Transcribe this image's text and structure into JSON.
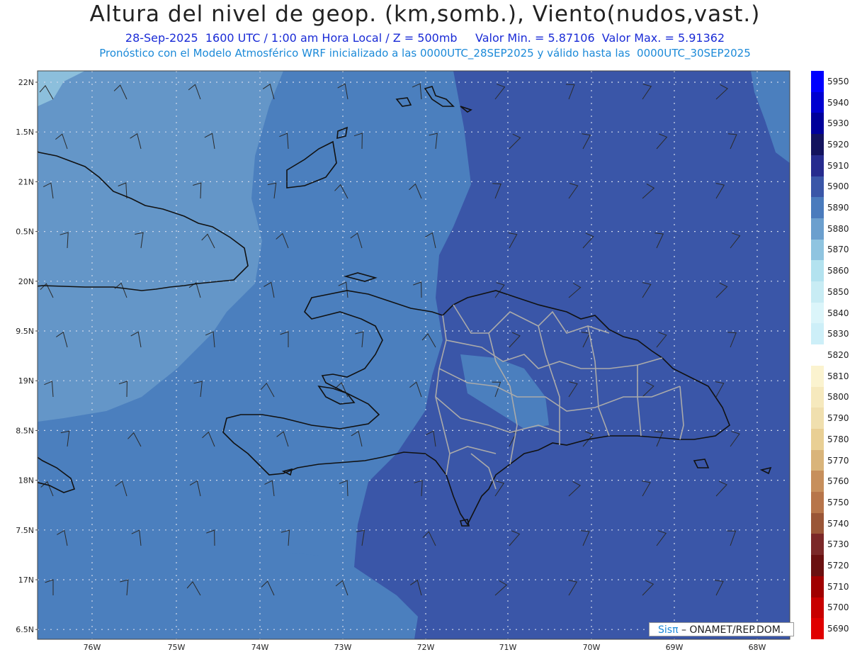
{
  "title": "Altura del nivel de geop. (km,somb.), Viento(nudos,vast.)",
  "subtitle_line1": "28-Sep-2025  1600 UTC / 1:00 am Hora Local / Z = 500mb     Valor Min. = 5.87106  Valor Max. = 5.91362",
  "subtitle_line2": "Pronóstico con el Modelo Atmosférico WRF inicializado a las 0000UTC_28SEP2025 y válido hasta las  0000UTC_30SEP2025",
  "axes": {
    "lat_labels": [
      "22N",
      "1.5N",
      "21N",
      "0.5N",
      "20N",
      "9.5N",
      "19N",
      "8.5N",
      "18N",
      "7.5N",
      "17N",
      "6.5N"
    ],
    "lon_labels": [
      "76W",
      "75W",
      "74W",
      "73W",
      "72W",
      "71W",
      "70W",
      "69W",
      "68W"
    ],
    "lat_range": [
      16.5,
      22.0
    ],
    "lon_range": [
      -76.6,
      -67.6
    ],
    "grid": "dotted"
  },
  "colorbar": {
    "labels": [
      "5950",
      "5940",
      "5930",
      "5920",
      "5910",
      "5900",
      "5890",
      "5880",
      "5870",
      "5860",
      "5850",
      "5840",
      "5830",
      "5820",
      "5810",
      "5800",
      "5790",
      "5780",
      "5770",
      "5760",
      "5750",
      "5740",
      "5730",
      "5720",
      "5710",
      "5700",
      "5690"
    ],
    "colors": [
      "#0000ff",
      "#0000d0",
      "#00009a",
      "#13135e",
      "#262b8e",
      "#3a56a8",
      "#4a7bbd",
      "#6b9fce",
      "#8fc4e0",
      "#b3e2ef",
      "#c8ecf4",
      "#dbf5fa",
      "#cdeff8",
      "#ffffff",
      "#fbf3cf",
      "#f6e9bd",
      "#f0dfae",
      "#e9cf94",
      "#d9b47a",
      "#c78f5c",
      "#b7754a",
      "#9a5637",
      "#7b2828",
      "#6a1010",
      "#a00000",
      "#c80000",
      "#e00000"
    ]
  },
  "colors": {
    "zone_5890": "#4b7fbe",
    "zone_5880": "#6496c8",
    "zone_5870": "#8cbfdc",
    "zone_5900": "#3a56a8",
    "coast": "#111111",
    "province_border": "#aaaaaa"
  },
  "credit": {
    "sis": "Sisπ",
    "org": "– ONAMET/REP.DOM."
  }
}
